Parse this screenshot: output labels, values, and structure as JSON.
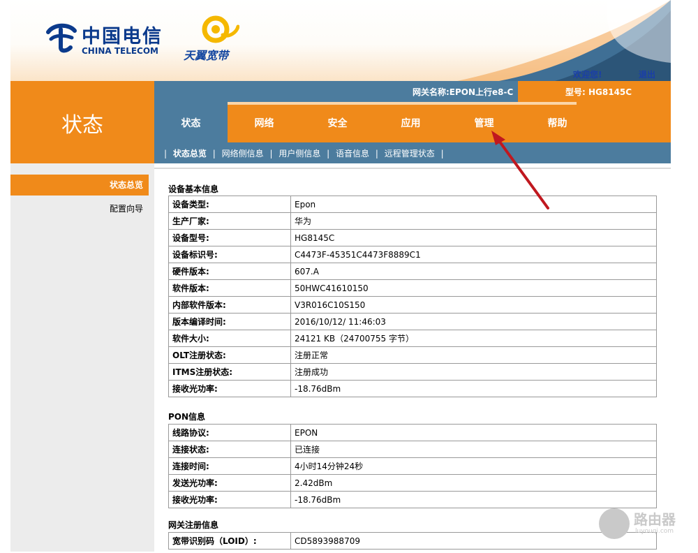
{
  "header": {
    "brand_cn": "中国电信",
    "brand_en": "CHINA TELECOM",
    "sub_brand": "天翼宽带",
    "welcome": "欢迎您!",
    "logout": "退出"
  },
  "page_title": "状态",
  "topbar": {
    "gateway_name": "网关名称:EPON上行e8-C",
    "model": "型号: HG8145C"
  },
  "tabs": [
    {
      "label": "状态"
    },
    {
      "label": "网络"
    },
    {
      "label": "安全"
    },
    {
      "label": "应用"
    },
    {
      "label": "管理"
    },
    {
      "label": "帮助"
    }
  ],
  "subnav": [
    {
      "label": "状态总览"
    },
    {
      "label": "网络侧信息"
    },
    {
      "label": "用户侧信息"
    },
    {
      "label": "语音信息"
    },
    {
      "label": "远程管理状态"
    }
  ],
  "sidebar": {
    "active": "状态总览",
    "item2": "配置向导"
  },
  "device_info": {
    "title": "设备基本信息",
    "rows": [
      {
        "k": "设备类型:",
        "v": "Epon"
      },
      {
        "k": "生产厂家:",
        "v": "华为"
      },
      {
        "k": "设备型号:",
        "v": "HG8145C"
      },
      {
        "k": "设备标识号:",
        "v": "C4473F-45351C4473F8889C1"
      },
      {
        "k": "硬件版本:",
        "v": "607.A"
      },
      {
        "k": "软件版本:",
        "v": "50HWC41610150"
      },
      {
        "k": "内部软件版本:",
        "v": "V3R016C10S150"
      },
      {
        "k": "版本编译时间:",
        "v": "2016/10/12/ 11:46:03"
      },
      {
        "k": "软件大小:",
        "v": "24121 KB（24700755 字节）"
      },
      {
        "k": "OLT注册状态:",
        "v": "注册正常"
      },
      {
        "k": "ITMS注册状态:",
        "v": "注册成功"
      },
      {
        "k": "接收光功率:",
        "v": "-18.76dBm"
      }
    ]
  },
  "pon_info": {
    "title": "PON信息",
    "rows": [
      {
        "k": "线路协议:",
        "v": "EPON"
      },
      {
        "k": "连接状态:",
        "v": "已连接"
      },
      {
        "k": "连接时间:",
        "v": "4小时14分钟24秒"
      },
      {
        "k": "发送光功率:",
        "v": "2.42dBm"
      },
      {
        "k": "接收光功率:",
        "v": "-18.76dBm"
      }
    ]
  },
  "gw_reg": {
    "title": "网关注册信息",
    "rows": [
      {
        "k": "宽带识别码（LOID）:",
        "v": "CD5893988709"
      }
    ]
  },
  "watermark": {
    "text": "路由器",
    "url": "luyouqi.com"
  },
  "colors": {
    "orange": "#f08a1a",
    "steel_blue": "#4c7c9e",
    "brand_blue": "#0b3a8c",
    "arrow_red": "#c0181f"
  }
}
